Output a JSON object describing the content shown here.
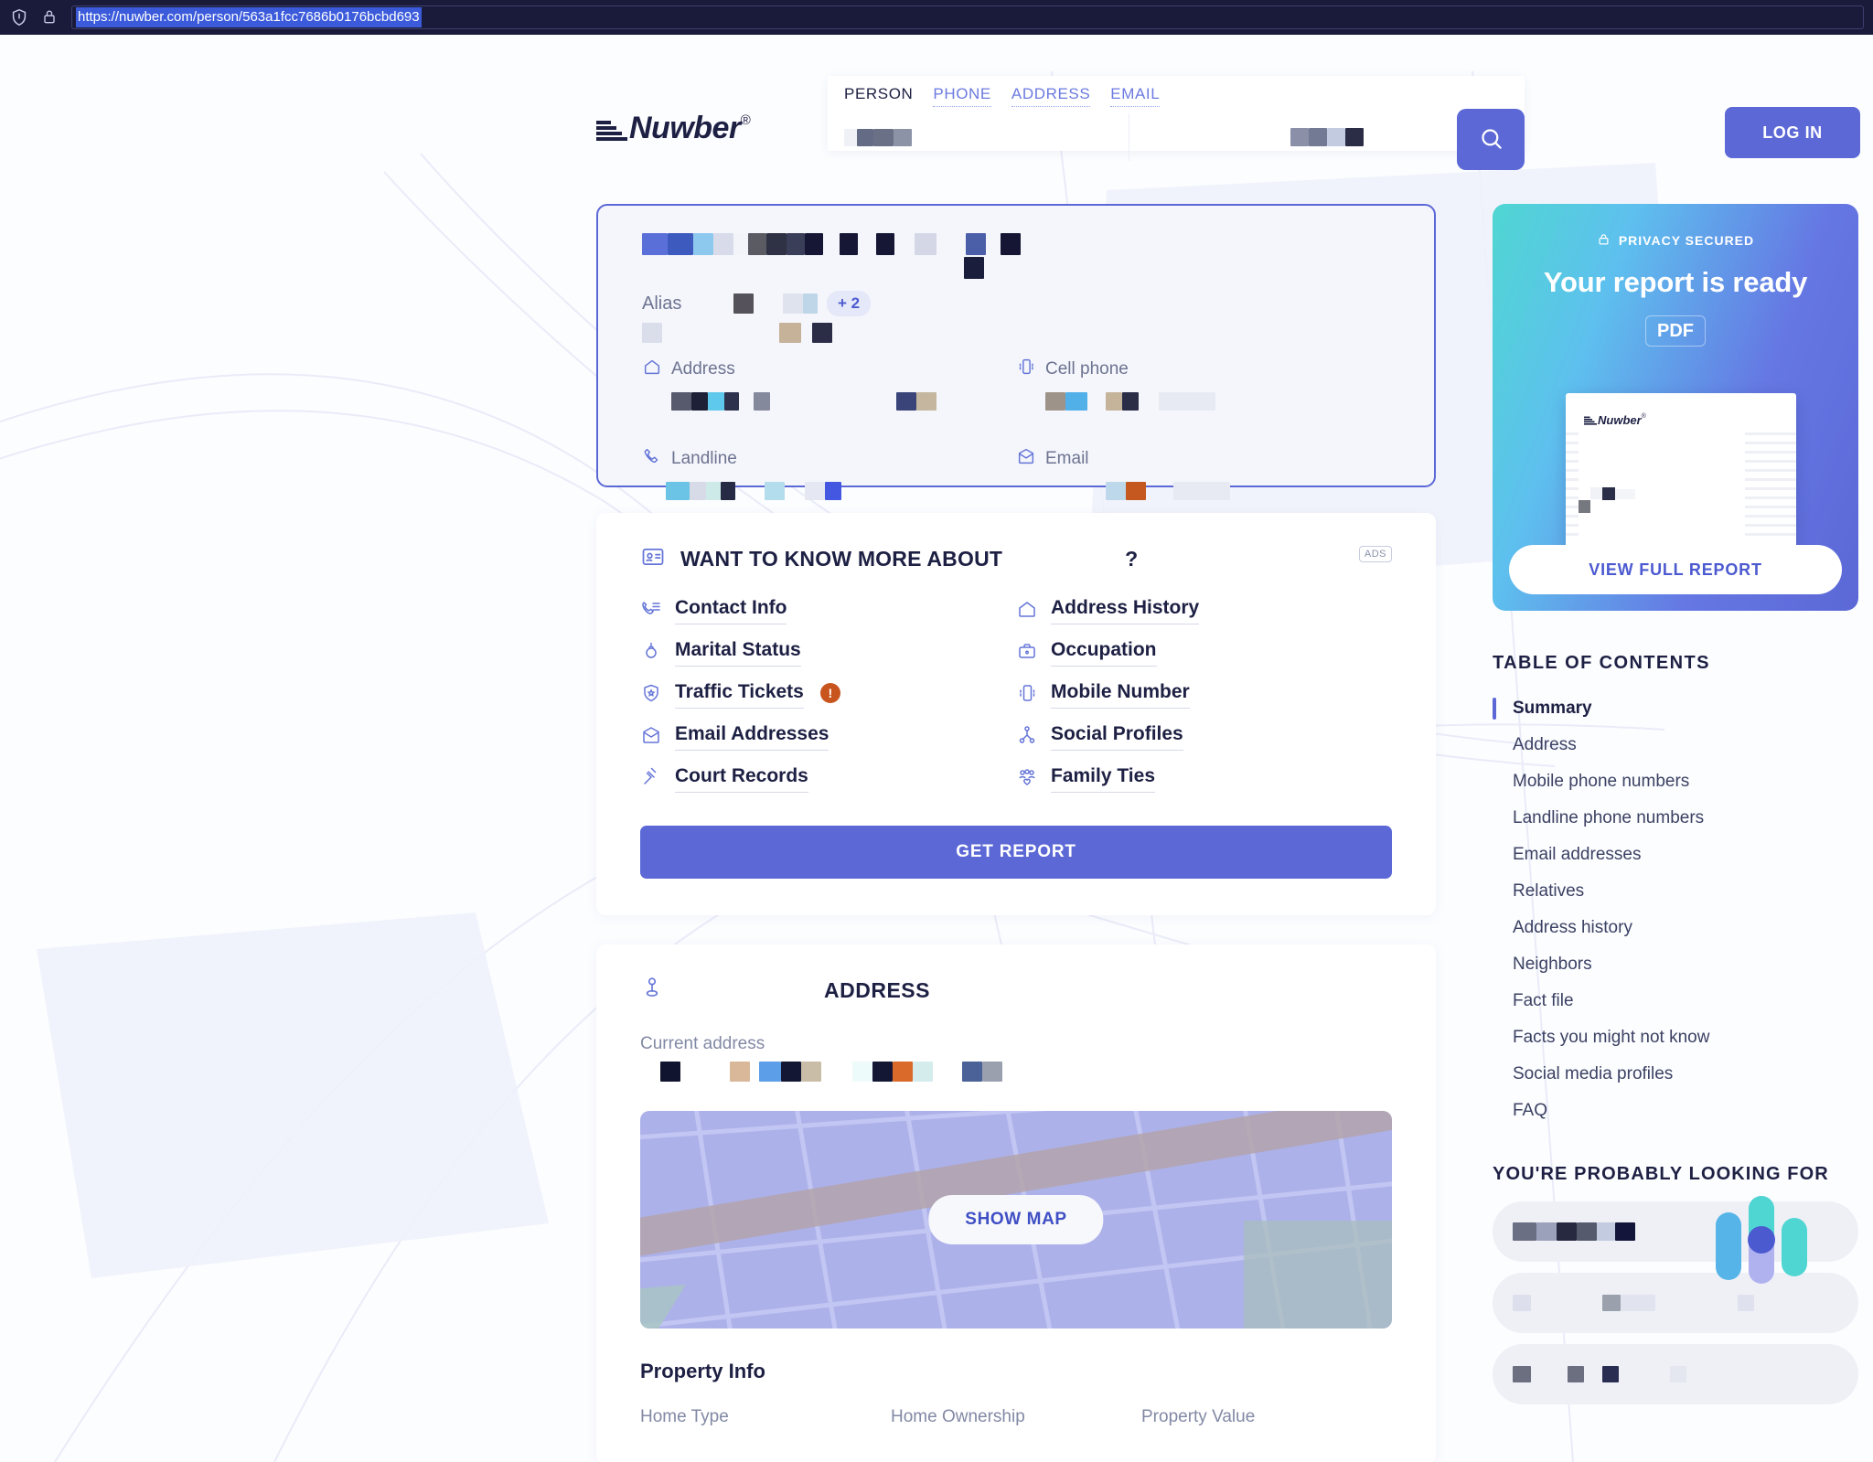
{
  "browser": {
    "url": "https://nuwber.com/person/563a1fcc7686b0176bcbd693",
    "shield_icon": "shield-icon",
    "lock_icon": "lock-icon"
  },
  "header": {
    "logo_text": "Nuwber",
    "logo_reg": "®",
    "search_tabs": [
      {
        "label": "PERSON",
        "active": true
      },
      {
        "label": "PHONE",
        "active": false
      },
      {
        "label": "ADDRESS",
        "active": false
      },
      {
        "label": "EMAIL",
        "active": false
      }
    ],
    "search_icon": "search-icon",
    "login_label": "LOG IN",
    "accent_color": "#5b68d6"
  },
  "summary": {
    "alias_label": "Alias",
    "alias_more": "+ 2",
    "fields": [
      {
        "label": "Address",
        "icon": "home-icon"
      },
      {
        "label": "Cell phone",
        "icon": "mobile-phone-icon"
      },
      {
        "label": "Landline",
        "icon": "telephone-icon"
      },
      {
        "label": "Email",
        "icon": "envelope-icon"
      }
    ]
  },
  "want_to_know": {
    "icon": "id-card-icon",
    "title": "WANT TO KNOW MORE ABOUT",
    "question_mark": "?",
    "ads_badge": "ADS",
    "items": [
      {
        "label": "Contact Info",
        "icon": "contact-phone-icon",
        "badge": ""
      },
      {
        "label": "Address History",
        "icon": "home-icon",
        "badge": ""
      },
      {
        "label": "Marital Status",
        "icon": "ring-icon",
        "badge": ""
      },
      {
        "label": "Occupation",
        "icon": "briefcase-icon",
        "badge": ""
      },
      {
        "label": "Traffic Tickets",
        "icon": "shield-star-icon",
        "badge": "!"
      },
      {
        "label": "Mobile Number",
        "icon": "mobile-phone-icon",
        "badge": ""
      },
      {
        "label": "Email Addresses",
        "icon": "envelope-icon",
        "badge": ""
      },
      {
        "label": "Social Profiles",
        "icon": "share-nodes-icon",
        "badge": ""
      },
      {
        "label": "Court Records",
        "icon": "gavel-icon",
        "badge": ""
      },
      {
        "label": "Family Ties",
        "icon": "family-icon",
        "badge": ""
      }
    ],
    "get_report_label": "GET REPORT"
  },
  "address_section": {
    "icon": "map-pin-icon",
    "title": "ADDRESS",
    "current_address_label": "Current address",
    "show_map_label": "SHOW MAP",
    "property_info_title": "Property Info",
    "property_columns": [
      "Home Type",
      "Home Ownership",
      "Property Value"
    ]
  },
  "sidebar": {
    "report_card": {
      "privacy_label": "PRIVACY SECURED",
      "lock_icon": "lock-icon",
      "headline": "Your report is ready",
      "format_chip": "PDF",
      "doc_logo_text": "Nuwber",
      "doc_logo_reg": "®",
      "cta_label": "VIEW FULL REPORT"
    },
    "toc_title": "TABLE OF CONTENTS",
    "toc_items": [
      {
        "label": "Summary",
        "active": true
      },
      {
        "label": "Address",
        "active": false
      },
      {
        "label": "Mobile phone numbers",
        "active": false
      },
      {
        "label": "Landline phone numbers",
        "active": false
      },
      {
        "label": "Email addresses",
        "active": false
      },
      {
        "label": "Relatives",
        "active": false
      },
      {
        "label": "Address history",
        "active": false
      },
      {
        "label": "Neighbors",
        "active": false
      },
      {
        "label": "Fact file",
        "active": false
      },
      {
        "label": "Facts you might not know",
        "active": false
      },
      {
        "label": "Social media profiles",
        "active": false
      },
      {
        "label": "FAQ",
        "active": false
      }
    ],
    "probably_looking_title": "YOU'RE PROBABLY LOOKING FOR"
  }
}
